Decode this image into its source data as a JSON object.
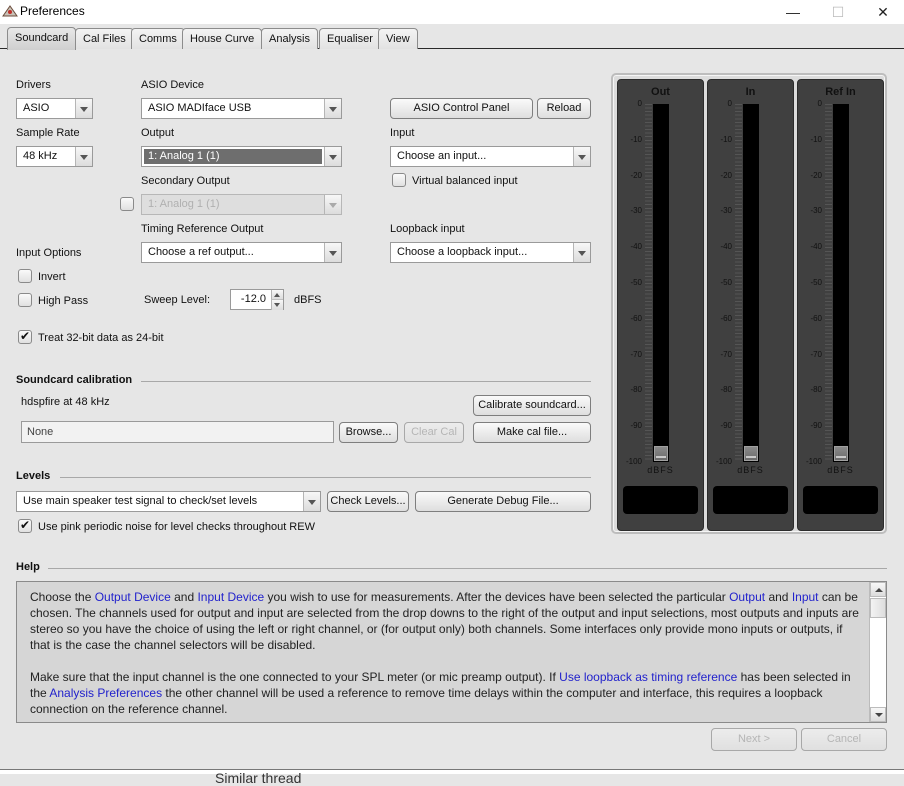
{
  "window": {
    "title": "Preferences",
    "icon": "rew-app-icon",
    "controls": {
      "minimize": "—",
      "maximize": "☐",
      "close": "✕"
    }
  },
  "tabs": [
    {
      "label": "Soundcard",
      "active": true
    },
    {
      "label": "Cal Files",
      "active": false
    },
    {
      "label": "Comms",
      "active": false
    },
    {
      "label": "House Curve",
      "active": false
    },
    {
      "label": "Analysis",
      "active": false
    },
    {
      "label": "Equaliser",
      "active": false
    },
    {
      "label": "View",
      "active": false
    }
  ],
  "soundcard": {
    "drivers": {
      "label": "Drivers",
      "value": "ASIO"
    },
    "sample_rate": {
      "label": "Sample Rate",
      "value": "48 kHz"
    },
    "asio_device": {
      "label": "ASIO Device",
      "value": "ASIO MADIface USB"
    },
    "asio_control_panel": "ASIO Control Panel",
    "reload": "Reload",
    "output": {
      "label": "Output",
      "value": "1: Analog 1 (1)"
    },
    "input": {
      "label": "Input",
      "value": "Choose an input..."
    },
    "virtual_balanced": {
      "label": "Virtual balanced input",
      "checked": false
    },
    "secondary_output": {
      "label": "Secondary Output",
      "value": "1: Analog 1 (1)",
      "enabled": false,
      "checked": false
    },
    "timing_ref_output": {
      "label": "Timing Reference Output",
      "value": "Choose a ref output..."
    },
    "loopback_input": {
      "label": "Loopback input",
      "value": "Choose a loopback input..."
    },
    "input_options": {
      "label": "Input Options",
      "invert": {
        "label": "Invert",
        "checked": false
      },
      "high_pass": {
        "label": "High Pass",
        "checked": false
      }
    },
    "sweep_level": {
      "label": "Sweep Level:",
      "value": "-12.0",
      "unit": "dBFS"
    },
    "treat_32bit": {
      "label": "Treat 32-bit data as 24-bit",
      "checked": true
    }
  },
  "calibration": {
    "title": "Soundcard calibration",
    "info": "hdspfire at 48 kHz",
    "file_value": "None",
    "browse": "Browse...",
    "clear_cal": "Clear Cal",
    "calibrate": "Calibrate soundcard...",
    "make_cal": "Make cal file..."
  },
  "levels": {
    "title": "Levels",
    "mode": "Use main speaker test signal to check/set levels",
    "check_levels": "Check Levels...",
    "debug": "Generate Debug File...",
    "pink_noise": {
      "label": "Use pink periodic noise for level checks throughout REW",
      "checked": true
    }
  },
  "meters": {
    "unit": "dBFS",
    "ticks": [
      "0",
      "-10",
      "-20",
      "-30",
      "-40",
      "-50",
      "-60",
      "-70",
      "-80",
      "-90",
      "-100"
    ],
    "range_db": [
      -100,
      0
    ],
    "channels": [
      {
        "name": "Out",
        "level_db": -100,
        "readout": ""
      },
      {
        "name": "In",
        "level_db": -100,
        "readout": ""
      },
      {
        "name": "Ref In",
        "level_db": -100,
        "readout": ""
      }
    ]
  },
  "help": {
    "title": "Help",
    "p1": [
      {
        "t": "Choose the "
      },
      {
        "t": "Output Device",
        "link": true
      },
      {
        "t": " and "
      },
      {
        "t": "Input Device",
        "link": true
      },
      {
        "t": " you wish to use for measurements. After the devices have been selected the particular "
      },
      {
        "t": "Output",
        "link": true
      },
      {
        "t": " and "
      },
      {
        "t": "Input",
        "link": true
      },
      {
        "t": " can be chosen. The channels used for output and input are selected from the drop downs to the right of the output and input selections, most outputs and inputs are stereo so you have the choice of using the left or right channel, or (for output only) both channels. Some interfaces only provide mono inputs or outputs, if that is the case the channel selectors will be disabled."
      }
    ],
    "p2": [
      {
        "t": "Make sure that the input channel is the one connected to your SPL meter (or mic preamp output). If "
      },
      {
        "t": "Use loopback as timing reference",
        "link": true
      },
      {
        "t": " has been selected in the "
      },
      {
        "t": "Analysis Preferences",
        "link": true
      },
      {
        "t": " the other channel will be used a reference to remove time delays within the computer and interface, this requires a loopback connection on the reference channel."
      }
    ]
  },
  "footer": {
    "next": "Next >",
    "cancel": "Cancel",
    "background_text": "Similar thread"
  },
  "colors": {
    "link": "#2222cc",
    "meter_bg": "#404040",
    "selected_combo": "#6e6e6e"
  }
}
